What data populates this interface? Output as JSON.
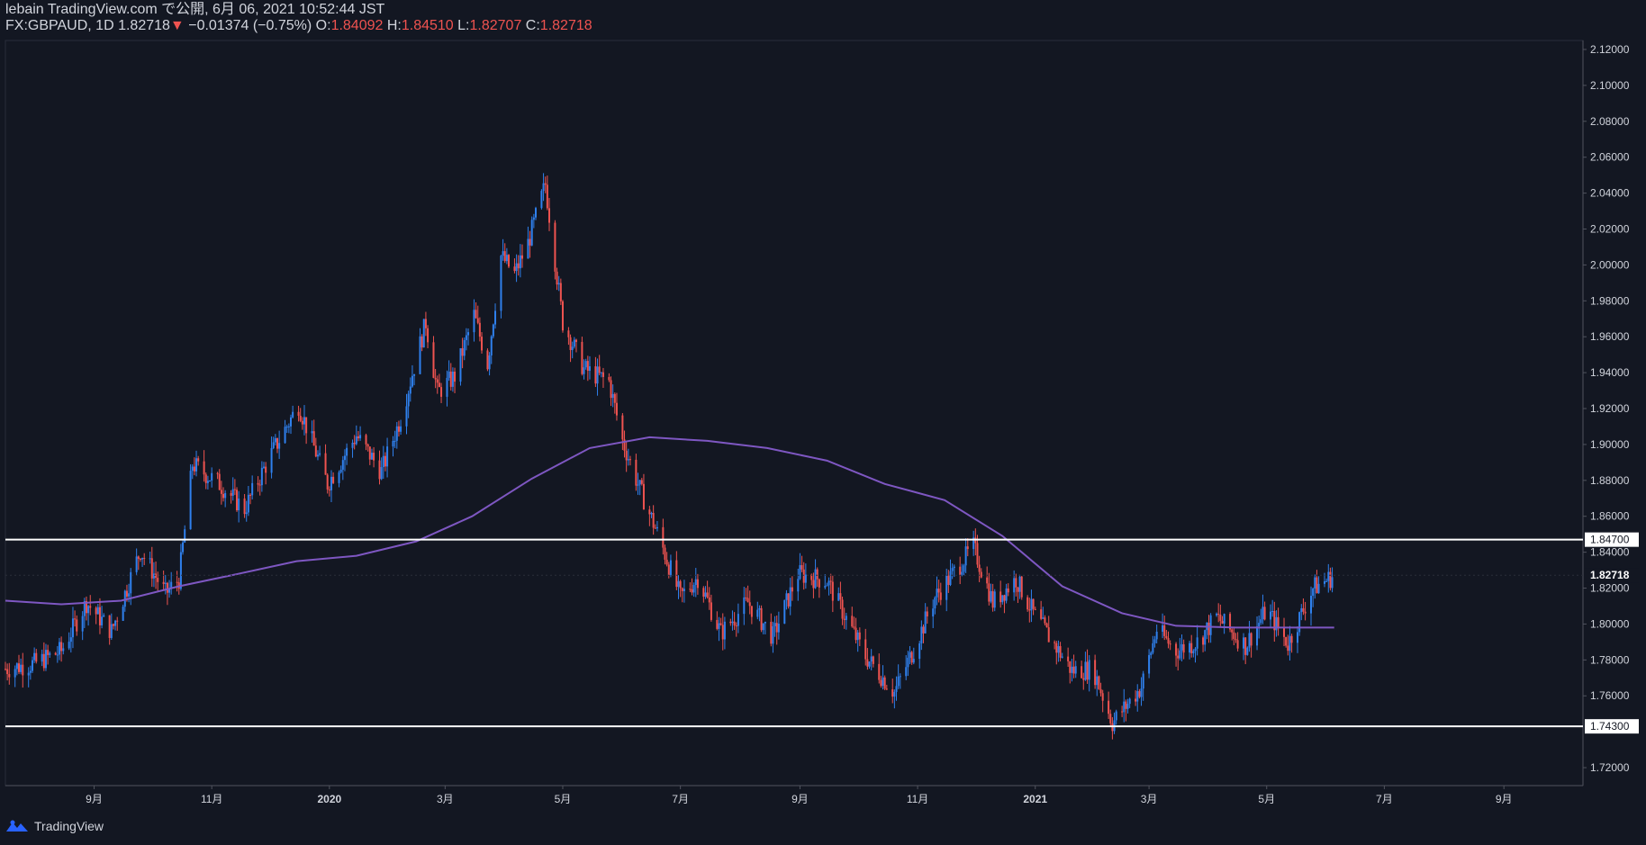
{
  "header": {
    "line1": "lebain TradingView.com で公開, 6月 06, 2021 10:52:44 JST",
    "symbol": "FX:GBPAUD, 1D",
    "last": "1.82718",
    "change_arrow": "▼",
    "change": "−0.01374 (−0.75%)",
    "o_label": "O:",
    "o_value": "1.84092",
    "h_label": "H:",
    "h_value": "1.84510",
    "l_label": "L:",
    "l_value": "1.82707",
    "c_label": "C:",
    "c_value": "1.82718"
  },
  "footer": {
    "brand": "TradingView"
  },
  "colors": {
    "background": "#131722",
    "up": "#2f80ed",
    "down": "#ef5350",
    "ma": "#7e57c2",
    "hline": "#ffffff",
    "text": "#d1d4dc"
  },
  "chart_data": {
    "type": "candlestick",
    "y_axis_ticks": [
      "2.12000",
      "2.10000",
      "2.08000",
      "2.06000",
      "2.04000",
      "2.02000",
      "2.00000",
      "1.98000",
      "1.96000",
      "1.94000",
      "1.92000",
      "1.90000",
      "1.88000",
      "1.86000",
      "1.84000",
      "1.82000",
      "1.80000",
      "1.78000",
      "1.76000",
      "1.72000"
    ],
    "ylim": [
      1.71,
      2.125
    ],
    "x_axis_ticks": [
      "9月",
      "11月",
      "2020",
      "3月",
      "5月",
      "7月",
      "9月",
      "11月",
      "2021",
      "3月",
      "5月",
      "7月",
      "9月"
    ],
    "x_start": "2019-07-17",
    "x_end": "2021-10-12",
    "horizontal_lines": [
      {
        "value": 1.847,
        "label": "1.84700"
      },
      {
        "value": 1.743,
        "label": "1.74300"
      }
    ],
    "last_price": {
      "value": 1.82718,
      "label": "1.82718"
    },
    "ma_line": [
      [
        "2019-07-17",
        1.813
      ],
      [
        "2019-08-15",
        1.811
      ],
      [
        "2019-09-15",
        1.813
      ],
      [
        "2019-10-15",
        1.821
      ],
      [
        "2019-11-15",
        1.828
      ],
      [
        "2019-12-15",
        1.835
      ],
      [
        "2020-01-15",
        1.838
      ],
      [
        "2020-02-15",
        1.846
      ],
      [
        "2020-03-15",
        1.86
      ],
      [
        "2020-04-15",
        1.881
      ],
      [
        "2020-05-15",
        1.898
      ],
      [
        "2020-06-15",
        1.904
      ],
      [
        "2020-07-15",
        1.902
      ],
      [
        "2020-08-15",
        1.898
      ],
      [
        "2020-09-15",
        1.891
      ],
      [
        "2020-10-15",
        1.878
      ],
      [
        "2020-11-15",
        1.869
      ],
      [
        "2020-12-15",
        1.849
      ],
      [
        "2021-01-15",
        1.821
      ],
      [
        "2021-02-15",
        1.806
      ],
      [
        "2021-03-15",
        1.799
      ],
      [
        "2021-04-15",
        1.798
      ],
      [
        "2021-05-15",
        1.798
      ],
      [
        "2021-06-05",
        1.798
      ]
    ],
    "price_path": [
      [
        "2019-07-17",
        1.775
      ],
      [
        "2019-08-01",
        1.778
      ],
      [
        "2019-08-15",
        1.785
      ],
      [
        "2019-08-28",
        1.812
      ],
      [
        "2019-09-10",
        1.796
      ],
      [
        "2019-09-25",
        1.841
      ],
      [
        "2019-10-08",
        1.817
      ],
      [
        "2019-10-15",
        1.825
      ],
      [
        "2019-10-22",
        1.889
      ],
      [
        "2019-11-05",
        1.878
      ],
      [
        "2019-11-18",
        1.864
      ],
      [
        "2019-12-01",
        1.893
      ],
      [
        "2019-12-16",
        1.922
      ],
      [
        "2019-12-31",
        1.878
      ],
      [
        "2020-01-15",
        1.905
      ],
      [
        "2020-01-28",
        1.885
      ],
      [
        "2020-02-07",
        1.915
      ],
      [
        "2020-02-20",
        1.968
      ],
      [
        "2020-02-26",
        1.929
      ],
      [
        "2020-03-06",
        1.938
      ],
      [
        "2020-03-16",
        1.972
      ],
      [
        "2020-03-23",
        1.945
      ],
      [
        "2020-03-30",
        2.005
      ],
      [
        "2020-04-06",
        1.995
      ],
      [
        "2020-04-13",
        2.012
      ],
      [
        "2020-04-22",
        2.045
      ],
      [
        "2020-05-01",
        1.968
      ],
      [
        "2020-05-12",
        1.942
      ],
      [
        "2020-05-25",
        1.935
      ],
      [
        "2020-06-01",
        1.902
      ],
      [
        "2020-06-10",
        1.875
      ],
      [
        "2020-06-20",
        1.848
      ],
      [
        "2020-07-01",
        1.815
      ],
      [
        "2020-07-10",
        1.826
      ],
      [
        "2020-07-22",
        1.795
      ],
      [
        "2020-08-05",
        1.812
      ],
      [
        "2020-08-18",
        1.793
      ],
      [
        "2020-08-31",
        1.828
      ],
      [
        "2020-09-15",
        1.824
      ],
      [
        "2020-10-05",
        1.782
      ],
      [
        "2020-10-20",
        1.762
      ],
      [
        "2020-10-30",
        1.786
      ],
      [
        "2020-11-10",
        1.815
      ],
      [
        "2020-11-30",
        1.843
      ],
      [
        "2020-12-10",
        1.812
      ],
      [
        "2020-12-22",
        1.825
      ],
      [
        "2020-12-31",
        1.806
      ],
      [
        "2021-01-10",
        1.79
      ],
      [
        "2021-01-20",
        1.774
      ],
      [
        "2021-01-31",
        1.775
      ],
      [
        "2021-02-10",
        1.745
      ],
      [
        "2021-02-25",
        1.765
      ],
      [
        "2021-03-05",
        1.797
      ],
      [
        "2021-03-15",
        1.785
      ],
      [
        "2021-03-26",
        1.79
      ],
      [
        "2021-04-05",
        1.804
      ],
      [
        "2021-04-20",
        1.788
      ],
      [
        "2021-05-01",
        1.808
      ],
      [
        "2021-05-12",
        1.789
      ],
      [
        "2021-05-25",
        1.82
      ],
      [
        "2021-06-05",
        1.827
      ]
    ]
  }
}
